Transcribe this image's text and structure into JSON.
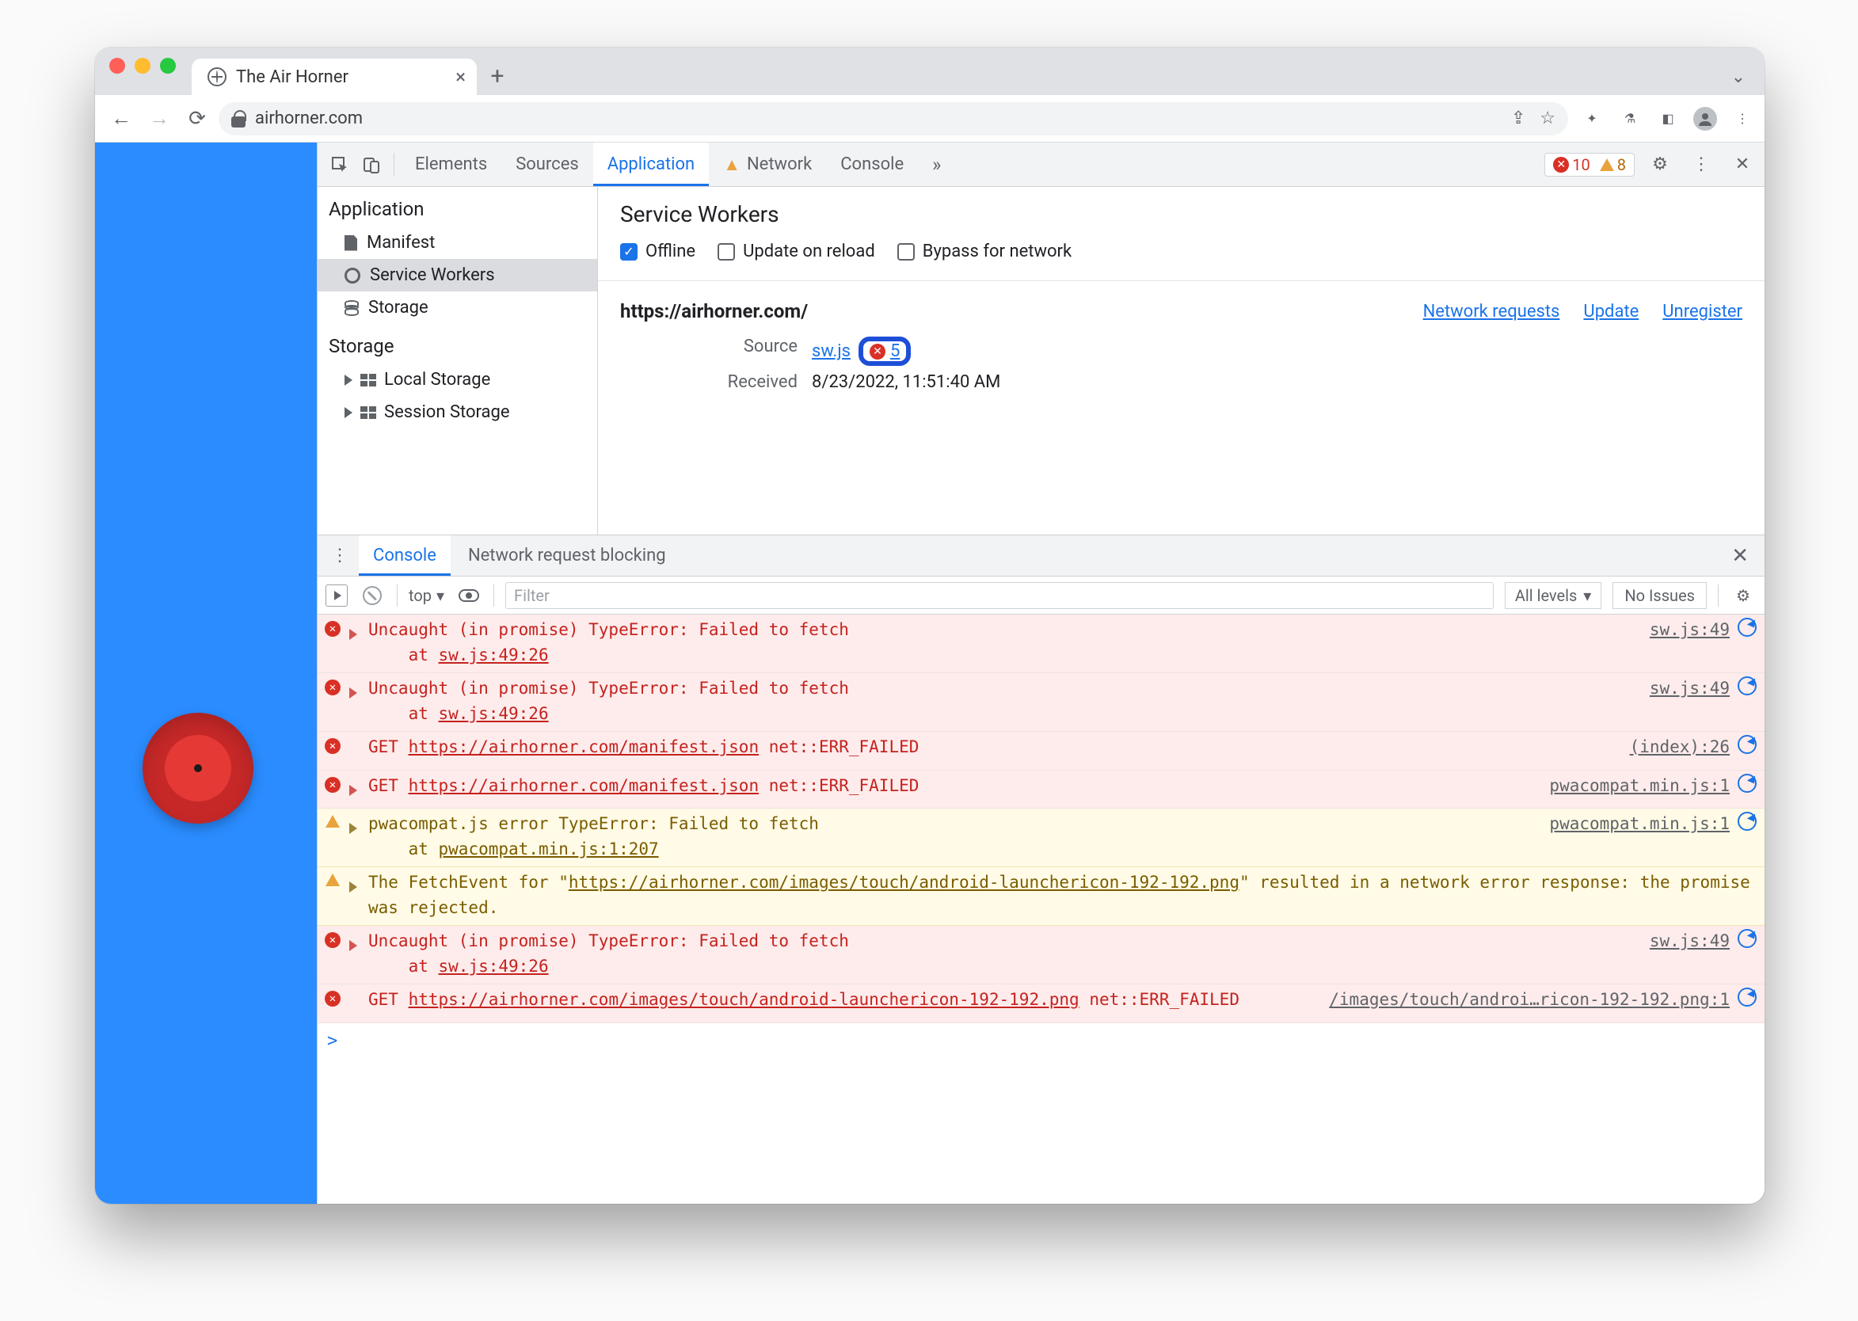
{
  "browser": {
    "tab_title": "The Air Horner",
    "url_host": "airhorner.com"
  },
  "devtools": {
    "tabs": [
      "Elements",
      "Sources",
      "Application",
      "Network",
      "Console"
    ],
    "active_tab": "Application",
    "errors": "10",
    "warnings": "8"
  },
  "app_sidebar": {
    "section1": "Application",
    "items1": [
      "Manifest",
      "Service Workers",
      "Storage"
    ],
    "section2": "Storage",
    "items2": [
      "Local Storage",
      "Session Storage"
    ]
  },
  "sw_panel": {
    "title": "Service Workers",
    "chk_offline": "Offline",
    "chk_update": "Update on reload",
    "chk_bypass": "Bypass for network",
    "origin": "https://airhorner.com/",
    "links": {
      "net": "Network requests",
      "update": "Update",
      "unreg": "Unregister"
    },
    "rows": {
      "source_label": "Source",
      "source_file": "sw.js",
      "source_err_count": "5",
      "received_label": "Received",
      "received_value": "8/23/2022, 11:51:40 AM"
    }
  },
  "drawer": {
    "tabs": [
      "Console",
      "Network request blocking"
    ],
    "active": "Console"
  },
  "console_toolbar": {
    "context": "top",
    "filter_placeholder": "Filter",
    "levels": "All levels",
    "issues": "No Issues"
  },
  "console": [
    {
      "type": "err",
      "expand": true,
      "msg": "Uncaught (in promise) TypeError: Failed to fetch\n    at ",
      "stack_link": "sw.js:49:26",
      "src": "sw.js:49"
    },
    {
      "type": "err",
      "expand": true,
      "msg": "Uncaught (in promise) TypeError: Failed to fetch\n    at ",
      "stack_link": "sw.js:49:26",
      "src": "sw.js:49"
    },
    {
      "type": "err",
      "expand": false,
      "prefix": "GET ",
      "url": "https://airhorner.com/manifest.json",
      "code": " net::ERR_FAILED",
      "src": "(index):26"
    },
    {
      "type": "err",
      "expand": true,
      "prefix": "GET ",
      "url": "https://airhorner.com/manifest.json",
      "code": " net::ERR_FAILED",
      "src": "pwacompat.min.js:1"
    },
    {
      "type": "wrn",
      "expand": true,
      "msg": "pwacompat.js error TypeError: Failed to fetch\n    at ",
      "stack_link": "pwacompat.min.js:1:207",
      "src": "pwacompat.min.js:1"
    },
    {
      "type": "wrn",
      "expand": true,
      "pre": "The FetchEvent for \"",
      "url": "https://airhorner.com/images/touch/android-launchericon-192-192.png",
      "post": "\" resulted in a network error response: the promise was rejected.",
      "src": ""
    },
    {
      "type": "err",
      "expand": true,
      "msg": "Uncaught (in promise) TypeError: Failed to fetch\n    at ",
      "stack_link": "sw.js:49:26",
      "src": "sw.js:49"
    },
    {
      "type": "err",
      "expand": false,
      "prefix": "GET ",
      "url": "https://airhorner.com/images/touch/android-launchericon-192-192.png",
      "code": " net::ERR_FAILED",
      "src": "/images/touch/androi…ricon-192-192.png:1"
    }
  ]
}
